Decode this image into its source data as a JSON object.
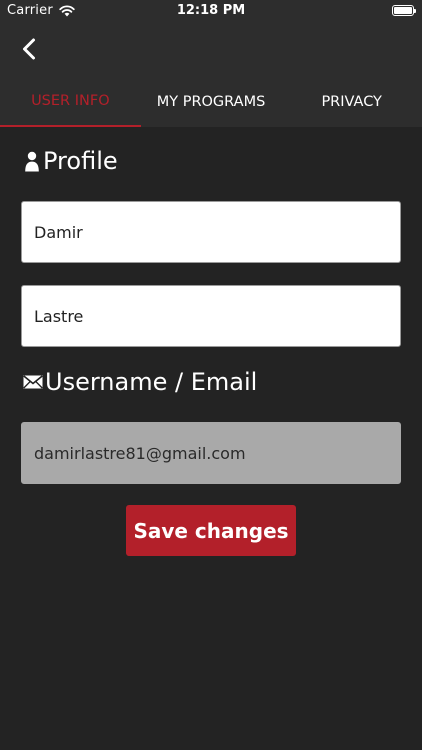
{
  "status_bar": {
    "carrier": "Carrier",
    "time": "12:18 PM"
  },
  "nav": {
    "back_icon": "chevron-left-icon"
  },
  "tabs": [
    {
      "label": "USER INFO",
      "active": true
    },
    {
      "label": "MY PROGRAMS",
      "active": false
    },
    {
      "label": "PRIVACY",
      "active": false
    }
  ],
  "profile": {
    "title": "Profile",
    "icon": "person-icon",
    "first_name": "Damir",
    "last_name": "Lastre"
  },
  "account": {
    "title": "Username / Email",
    "icon": "envelope-icon",
    "email": "damirlastre81@gmail.com"
  },
  "actions": {
    "save_label": "Save changes"
  },
  "colors": {
    "background": "#232323",
    "header": "#2d2d2d",
    "accent": "#b3202a",
    "readonly_field": "#a9a9a9"
  }
}
